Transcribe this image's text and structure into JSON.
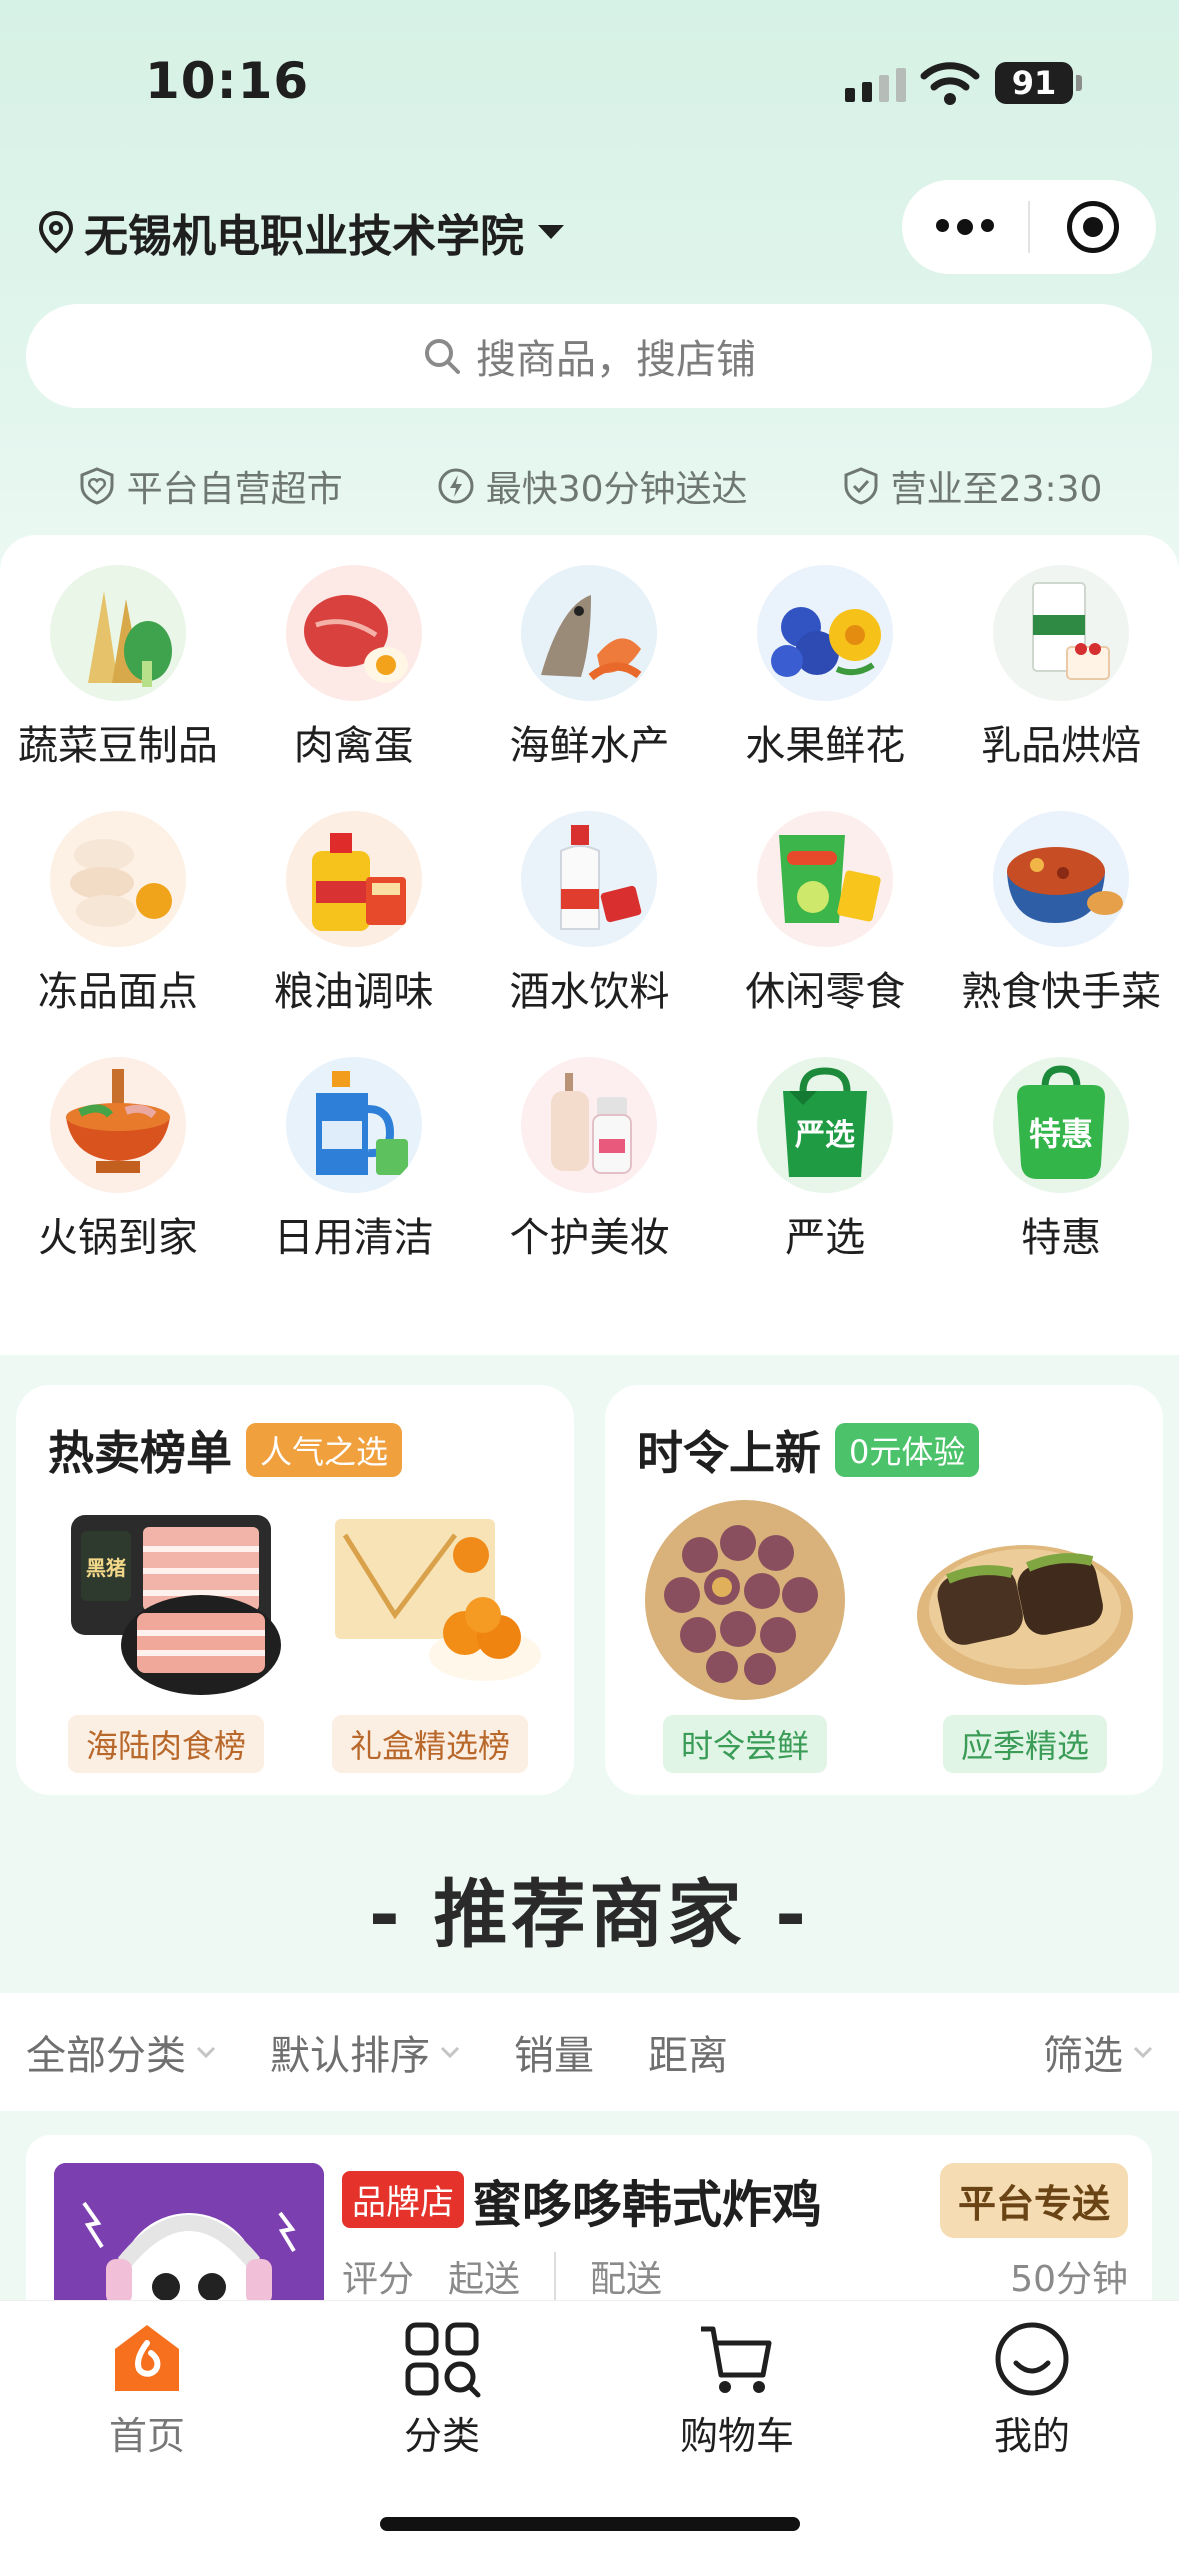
{
  "status_bar": {
    "time": "10:16",
    "battery": "91"
  },
  "header": {
    "location": "无锡机电职业技术学院"
  },
  "search": {
    "placeholder": "搜商品，搜店铺"
  },
  "features": [
    {
      "icon": "shield-heart-icon",
      "label": "平台自营超市"
    },
    {
      "icon": "lightning-icon",
      "label": "最快30分钟送达"
    },
    {
      "icon": "shield-check-icon",
      "label": "营业至23:30"
    }
  ],
  "categories": [
    {
      "label": "蔬菜豆制品",
      "icon": "vegetables-icon"
    },
    {
      "label": "肉禽蛋",
      "icon": "meat-egg-icon"
    },
    {
      "label": "海鲜水产",
      "icon": "seafood-icon"
    },
    {
      "label": "水果鲜花",
      "icon": "fruit-flower-icon"
    },
    {
      "label": "乳品烘焙",
      "icon": "dairy-bakery-icon"
    },
    {
      "label": "冻品面点",
      "icon": "frozen-dumpling-icon"
    },
    {
      "label": "粮油调味",
      "icon": "oil-seasoning-icon"
    },
    {
      "label": "酒水饮料",
      "icon": "liquor-drink-icon"
    },
    {
      "label": "休闲零食",
      "icon": "snack-icon"
    },
    {
      "label": "熟食快手菜",
      "icon": "cooked-food-icon"
    },
    {
      "label": "火锅到家",
      "icon": "hotpot-icon"
    },
    {
      "label": "日用清洁",
      "icon": "cleaning-icon"
    },
    {
      "label": "个护美妆",
      "icon": "cosmetics-icon"
    },
    {
      "label": "严选",
      "icon": "bag-icon",
      "img_text": "严选"
    },
    {
      "label": "特惠",
      "icon": "discount-bag-icon",
      "img_text": "特惠"
    }
  ],
  "promos": {
    "hot": {
      "title": "热卖榜单",
      "badge": "人气之选",
      "items": [
        {
          "label": "海陆肉食榜",
          "img_text": "黑猪"
        },
        {
          "label": "礼盒精选榜"
        }
      ]
    },
    "seasonal": {
      "title": "时令上新",
      "badge": "0元体验",
      "items": [
        {
          "label": "时令尝鲜"
        },
        {
          "label": "应季精选"
        }
      ]
    }
  },
  "recommend": {
    "title": "- 推荐商家 -",
    "sort": {
      "all": "全部分类",
      "default": "默认排序",
      "sales": "销量",
      "distance": "距离",
      "filter": "筛选"
    },
    "store": {
      "tag": "品牌店",
      "name": "蜜哆哆韩式炸鸡",
      "exclusive": "平台专送",
      "rating_label": "评分",
      "min_order_label": "起送",
      "delivery_label": "配送",
      "time": "50分钟"
    }
  },
  "tabbar": [
    {
      "label": "首页",
      "icon": "home-icon",
      "active": true
    },
    {
      "label": "分类",
      "icon": "grid-icon"
    },
    {
      "label": "购物车",
      "icon": "cart-icon"
    },
    {
      "label": "我的",
      "icon": "smile-icon"
    }
  ],
  "colors": {
    "brand_orange": "#f7701e",
    "accent_green": "#4cc36a",
    "tag_red": "#e5322a"
  }
}
